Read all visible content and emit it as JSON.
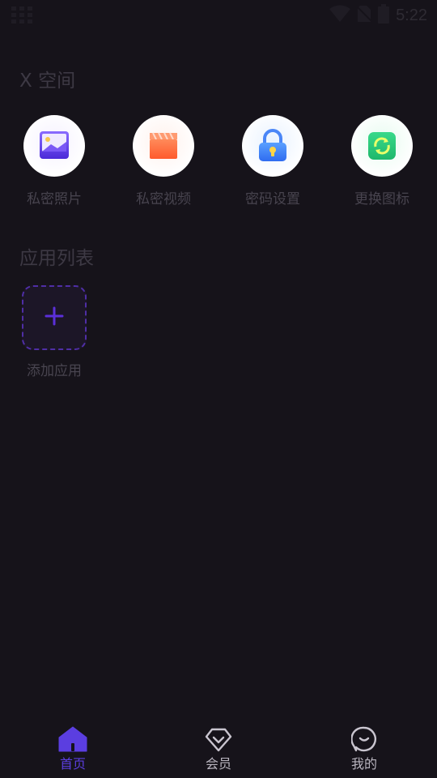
{
  "status_bar": {
    "time": "5:22"
  },
  "space": {
    "title": "X 空间",
    "features": [
      {
        "label": "私密照片",
        "icon": "photo-icon"
      },
      {
        "label": "私密视频",
        "icon": "video-clapper-icon"
      },
      {
        "label": "密码设置",
        "icon": "lock-icon"
      },
      {
        "label": "更换图标",
        "icon": "swap-icon"
      }
    ]
  },
  "apps": {
    "title": "应用列表",
    "add_label": "添加应用"
  },
  "bottom_nav": {
    "items": [
      {
        "label": "首页",
        "icon": "home-icon",
        "active": true
      },
      {
        "label": "会员",
        "icon": "diamond-icon",
        "active": false
      },
      {
        "label": "我的",
        "icon": "profile-face-icon",
        "active": false
      }
    ]
  },
  "colors": {
    "background": "#16131a",
    "accent": "#5b3ee0",
    "dashed_border": "#4f2ea6"
  }
}
